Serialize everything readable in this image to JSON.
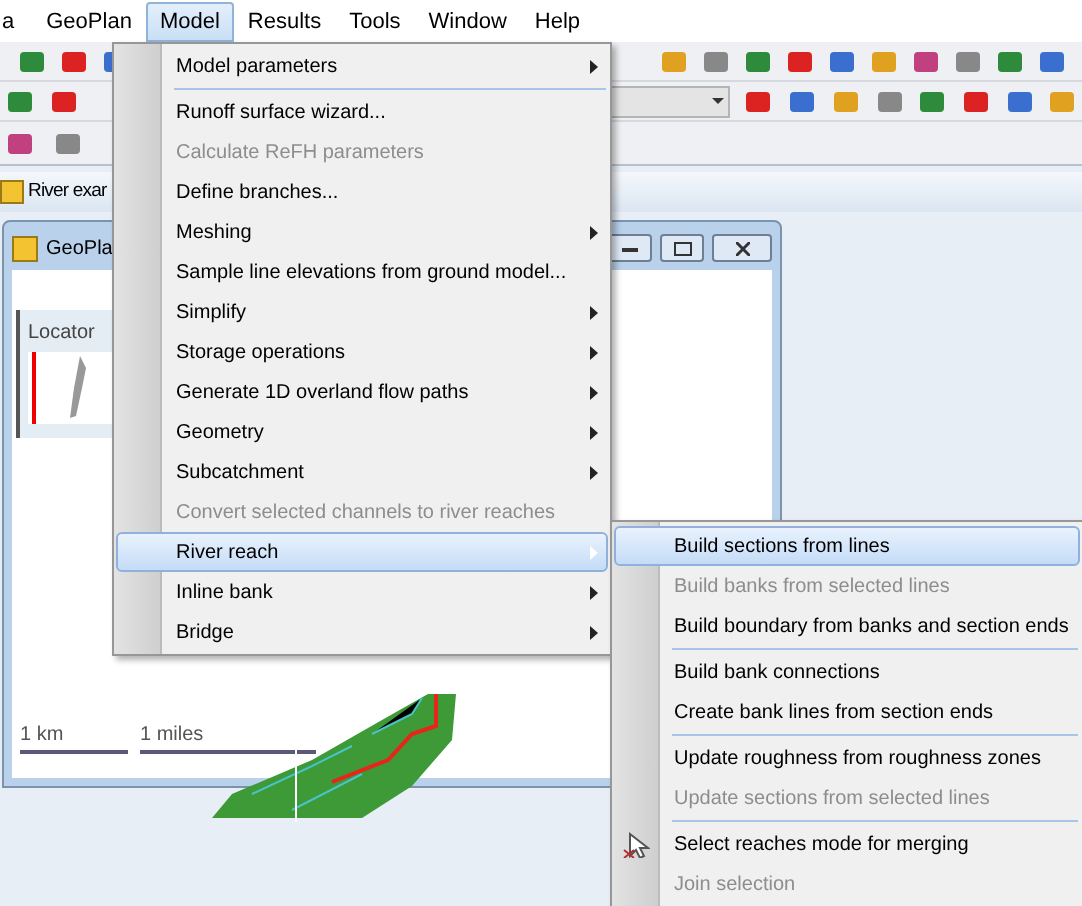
{
  "menubar": [
    {
      "label": "a",
      "selected": false
    },
    {
      "label": "GeoPlan",
      "selected": false
    },
    {
      "label": "Model",
      "selected": true
    },
    {
      "label": "Results",
      "selected": false
    },
    {
      "label": "Tools",
      "selected": false
    },
    {
      "label": "Window",
      "selected": false
    },
    {
      "label": "Help",
      "selected": false
    }
  ],
  "document_tab": {
    "title": "River exar"
  },
  "child_window": {
    "title": "GeoPla",
    "locator": {
      "title": "Locator"
    },
    "scale_bars": [
      "1 km",
      "1 miles"
    ]
  },
  "menu": {
    "items": [
      {
        "kind": "item",
        "label": "Model parameters",
        "submenu": true,
        "disabled": false,
        "selected": false
      },
      {
        "kind": "separator"
      },
      {
        "kind": "item",
        "label": "Runoff surface wizard...",
        "submenu": false,
        "disabled": false,
        "selected": false
      },
      {
        "kind": "item",
        "label": "Calculate ReFH parameters",
        "submenu": false,
        "disabled": true,
        "selected": false
      },
      {
        "kind": "item",
        "label": "Define branches...",
        "submenu": false,
        "disabled": false,
        "selected": false
      },
      {
        "kind": "item",
        "label": "Meshing",
        "submenu": true,
        "disabled": false,
        "selected": false
      },
      {
        "kind": "item",
        "label": "Sample line elevations from ground model...",
        "submenu": false,
        "disabled": false,
        "selected": false
      },
      {
        "kind": "item",
        "label": "Simplify",
        "submenu": true,
        "disabled": false,
        "selected": false
      },
      {
        "kind": "item",
        "label": "Storage operations",
        "submenu": true,
        "disabled": false,
        "selected": false
      },
      {
        "kind": "item",
        "label": "Generate 1D overland flow paths",
        "submenu": true,
        "disabled": false,
        "selected": false
      },
      {
        "kind": "item",
        "label": "Geometry",
        "submenu": true,
        "disabled": false,
        "selected": false
      },
      {
        "kind": "item",
        "label": "Subcatchment",
        "submenu": true,
        "disabled": false,
        "selected": false
      },
      {
        "kind": "item",
        "label": "Convert selected channels to river reaches",
        "submenu": false,
        "disabled": true,
        "selected": false
      },
      {
        "kind": "item",
        "label": "River reach",
        "submenu": true,
        "disabled": false,
        "selected": true
      },
      {
        "kind": "item",
        "label": "Inline bank",
        "submenu": true,
        "disabled": false,
        "selected": false
      },
      {
        "kind": "item",
        "label": "Bridge",
        "submenu": true,
        "disabled": false,
        "selected": false
      }
    ]
  },
  "submenu": {
    "items": [
      {
        "kind": "item",
        "label": "Build sections from lines",
        "disabled": false,
        "selected": true
      },
      {
        "kind": "item",
        "label": "Build banks from selected lines",
        "disabled": true,
        "selected": false
      },
      {
        "kind": "item",
        "label": "Build boundary from banks and section ends",
        "disabled": false,
        "selected": false
      },
      {
        "kind": "separator"
      },
      {
        "kind": "item",
        "label": "Build bank connections",
        "disabled": false,
        "selected": false
      },
      {
        "kind": "item",
        "label": "Create bank lines from section ends",
        "disabled": false,
        "selected": false
      },
      {
        "kind": "separator"
      },
      {
        "kind": "item",
        "label": "Update roughness from roughness zones",
        "disabled": false,
        "selected": false
      },
      {
        "kind": "item",
        "label": "Update sections from selected lines",
        "disabled": true,
        "selected": false
      },
      {
        "kind": "separator"
      },
      {
        "kind": "icon_item",
        "label": "Select reaches mode for merging",
        "disabled": false,
        "selected": false
      },
      {
        "kind": "item",
        "label": "Join selection",
        "disabled": true,
        "selected": false
      }
    ]
  }
}
